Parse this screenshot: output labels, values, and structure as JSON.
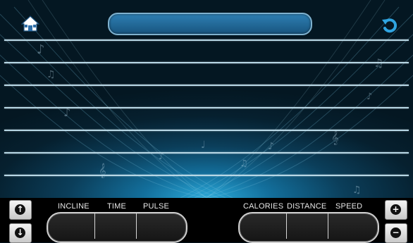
{
  "header": {
    "title": "",
    "home_icon": "home-icon",
    "back_icon": "refresh-back-icon"
  },
  "colors": {
    "background_top": "#041722",
    "glow": "#2aa9d9",
    "line": "#b8d8e6",
    "title_bar": "#2e7fb3",
    "bottom_bar": "#000000"
  },
  "controls": {
    "left_up_icon": "arrow-up-icon",
    "left_down_icon": "arrow-down-icon",
    "right_plus_icon": "plus-icon",
    "right_minus_icon": "minus-icon"
  },
  "stats_left": {
    "labels": [
      "INCLINE",
      "TIME",
      "PULSE"
    ],
    "values": [
      "",
      "",
      ""
    ]
  },
  "stats_right": {
    "labels": [
      "CALORIES",
      "DISTANCE",
      "SPEED"
    ],
    "values": [
      "",
      "",
      ""
    ]
  }
}
